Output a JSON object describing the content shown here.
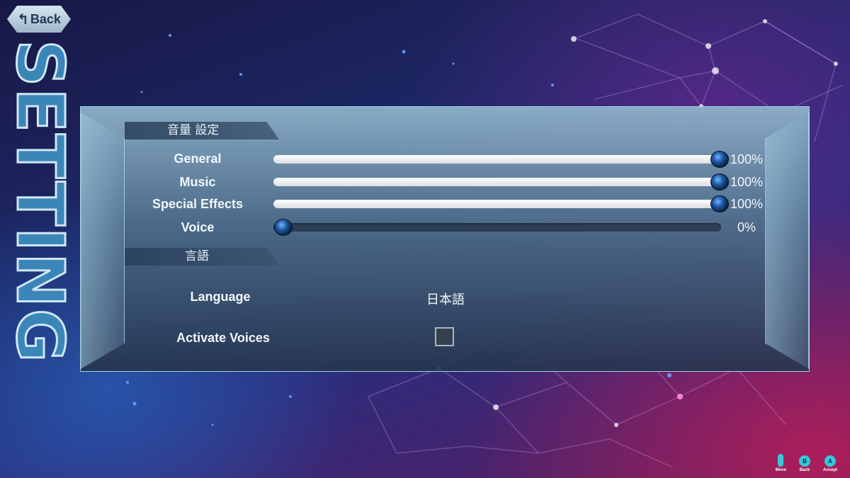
{
  "header": {
    "back_label": "Back",
    "title": "SETTING"
  },
  "volume_section": {
    "title": "音量 設定",
    "sliders": [
      {
        "label": "General",
        "value": 100,
        "display": "100%"
      },
      {
        "label": "Music",
        "value": 100,
        "display": "100%"
      },
      {
        "label": "Special Effects",
        "value": 100,
        "display": "100%"
      },
      {
        "label": "Voice",
        "value": 0,
        "display": "0%"
      }
    ]
  },
  "language_section": {
    "title": "言語",
    "language_label": "Language",
    "language_value": "日本語",
    "activate_voices_label": "Activate Voices",
    "activate_voices_checked": false
  },
  "hints": [
    {
      "icon": "dpad-icon",
      "glyph": "",
      "label": "Move"
    },
    {
      "icon": "b-button-icon",
      "glyph": "B",
      "label": "Back"
    },
    {
      "icon": "a-button-icon",
      "glyph": "A",
      "label": "Accept"
    }
  ],
  "colors": {
    "accent": "#36c7d9",
    "knob": "#1d5aa8",
    "panel_border": "#9fd1ea"
  }
}
